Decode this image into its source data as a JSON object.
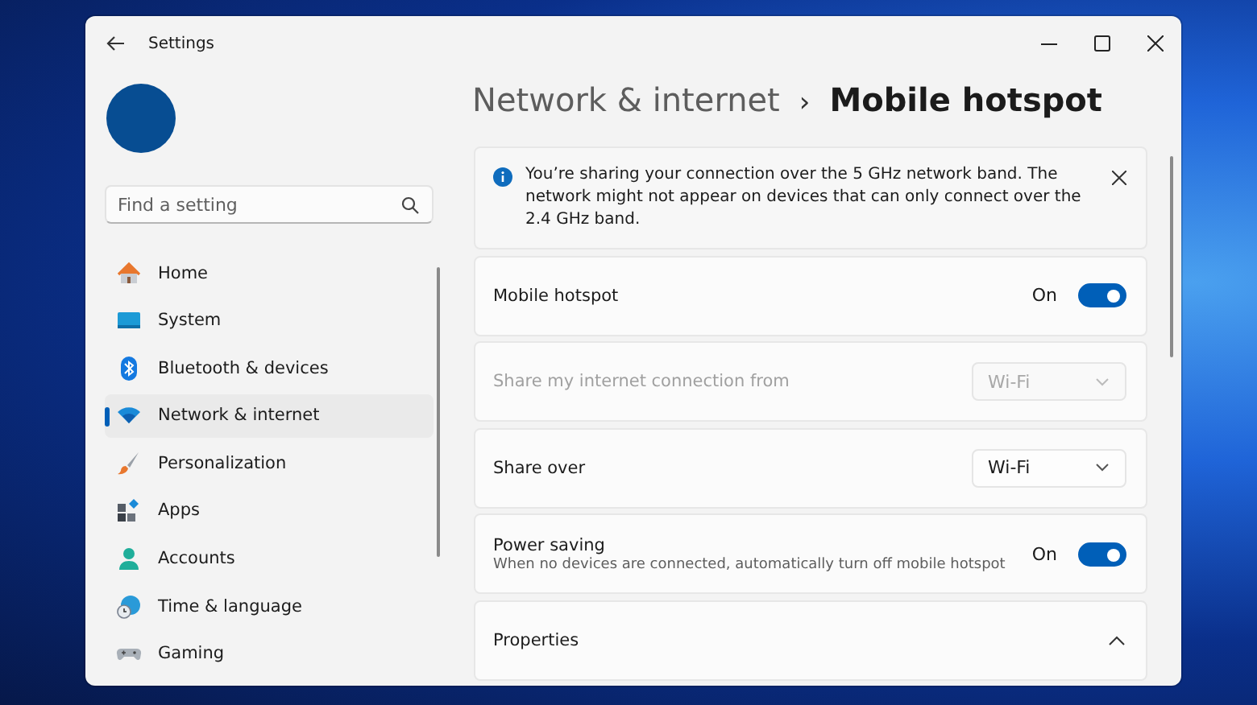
{
  "window": {
    "title": "Settings"
  },
  "search": {
    "placeholder": "Find a setting"
  },
  "sidebar": {
    "items": [
      {
        "label": "Home",
        "selected": false
      },
      {
        "label": "System",
        "selected": false
      },
      {
        "label": "Bluetooth & devices",
        "selected": false
      },
      {
        "label": "Network & internet",
        "selected": true
      },
      {
        "label": "Personalization",
        "selected": false
      },
      {
        "label": "Apps",
        "selected": false
      },
      {
        "label": "Accounts",
        "selected": false
      },
      {
        "label": "Time & language",
        "selected": false
      },
      {
        "label": "Gaming",
        "selected": false
      }
    ]
  },
  "breadcrumb": {
    "parent": "Network & internet",
    "separator": "›",
    "current": "Mobile hotspot"
  },
  "info_bar": {
    "message": "You’re sharing your connection over the 5 GHz network band. The network might not appear on devices that can only connect over the 2.4 GHz band."
  },
  "settings": [
    {
      "kind": "toggle",
      "label": "Mobile hotspot",
      "state_text": "On",
      "on": true,
      "disabled": false
    },
    {
      "kind": "dropdown",
      "label": "Share my internet connection from",
      "value": "Wi-Fi",
      "disabled": true
    },
    {
      "kind": "dropdown",
      "label": "Share over",
      "value": "Wi-Fi",
      "disabled": false
    },
    {
      "kind": "toggle",
      "label": "Power saving",
      "description": "When no devices are connected, automatically turn off mobile hotspot",
      "state_text": "On",
      "on": true,
      "disabled": false
    },
    {
      "kind": "expander",
      "label": "Properties",
      "expanded": true,
      "disabled": false
    }
  ]
}
